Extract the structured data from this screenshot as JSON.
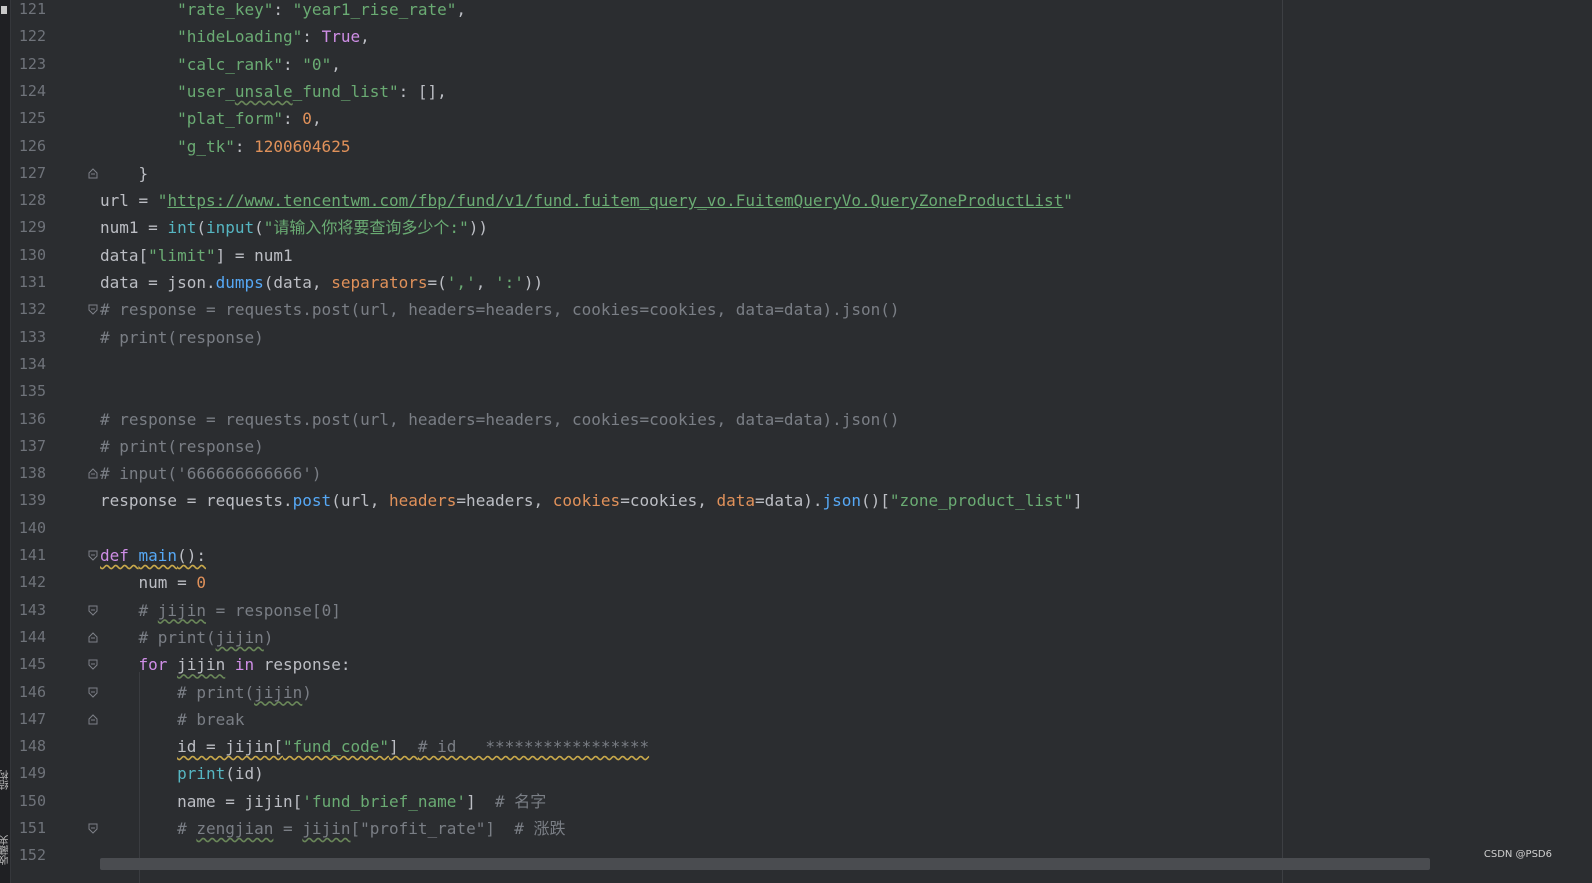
{
  "sidebar": {
    "structure_label": "结构",
    "bookmarks_label": "收藏夹"
  },
  "watermark": "CSDN @PSD6",
  "editor": {
    "lines": [
      {
        "n": "121",
        "fold": "",
        "tokens": [
          [
            "",
            "        "
          ],
          [
            "str",
            "\"rate_key\""
          ],
          [
            "",
            ": "
          ],
          [
            "str",
            "\"year1_rise_rate\""
          ],
          [
            "",
            ","
          ]
        ]
      },
      {
        "n": "122",
        "fold": "",
        "tokens": [
          [
            "",
            "        "
          ],
          [
            "str",
            "\"hideLoading\""
          ],
          [
            "",
            ": "
          ],
          [
            "kw",
            "True"
          ],
          [
            "",
            ","
          ]
        ]
      },
      {
        "n": "123",
        "fold": "",
        "tokens": [
          [
            "",
            "        "
          ],
          [
            "str",
            "\"calc_rank\""
          ],
          [
            "",
            ": "
          ],
          [
            "str",
            "\"0\""
          ],
          [
            "",
            ","
          ]
        ]
      },
      {
        "n": "124",
        "fold": "",
        "tokens": [
          [
            "",
            "        "
          ],
          [
            "str",
            "\"user_"
          ],
          [
            "str squig",
            "unsale"
          ],
          [
            "str",
            "_fund_list\""
          ],
          [
            "",
            ": [],"
          ]
        ]
      },
      {
        "n": "125",
        "fold": "",
        "tokens": [
          [
            "",
            "        "
          ],
          [
            "str",
            "\"plat_form\""
          ],
          [
            "",
            ": "
          ],
          [
            "num",
            "0"
          ],
          [
            "",
            ","
          ]
        ]
      },
      {
        "n": "126",
        "fold": "",
        "tokens": [
          [
            "",
            "        "
          ],
          [
            "str",
            "\"g_tk\""
          ],
          [
            "",
            ": "
          ],
          [
            "num",
            "1200604625"
          ]
        ]
      },
      {
        "n": "127",
        "fold": "end",
        "tokens": [
          [
            "",
            "    }"
          ]
        ]
      },
      {
        "n": "128",
        "fold": "",
        "tokens": [
          [
            "",
            "url = "
          ],
          [
            "str",
            "\""
          ],
          [
            "link",
            "https://www.tencentwm.com/fbp/fund/v1/fund.fuitem_query_vo.FuitemQueryVo.QueryZoneProductList"
          ],
          [
            "str",
            "\""
          ]
        ]
      },
      {
        "n": "129",
        "fold": "",
        "tokens": [
          [
            "",
            "num1 = "
          ],
          [
            "builtin",
            "int"
          ],
          [
            "",
            "("
          ],
          [
            "builtin",
            "input"
          ],
          [
            "",
            "("
          ],
          [
            "str",
            "\"请输入你将要查询多少个:\""
          ],
          [
            "",
            "))"
          ]
        ]
      },
      {
        "n": "130",
        "fold": "",
        "tokens": [
          [
            "",
            "data["
          ],
          [
            "str",
            "\"limit\""
          ],
          [
            "",
            "] = num1"
          ]
        ]
      },
      {
        "n": "131",
        "fold": "",
        "tokens": [
          [
            "",
            "data = json."
          ],
          [
            "fn",
            "dumps"
          ],
          [
            "",
            "(data, "
          ],
          [
            "param",
            "separators"
          ],
          [
            "",
            "=("
          ],
          [
            "str",
            "','"
          ],
          [
            "",
            ", "
          ],
          [
            "str",
            "':'"
          ],
          [
            "",
            "))"
          ]
        ]
      },
      {
        "n": "132",
        "fold": "start",
        "tokens": [
          [
            "cmt",
            "# response = requests.post(url, headers=headers, cookies=cookies, data=data).json()"
          ]
        ]
      },
      {
        "n": "133",
        "fold": "",
        "tokens": [
          [
            "cmt",
            "# print(response)"
          ]
        ]
      },
      {
        "n": "134",
        "fold": "",
        "tokens": []
      },
      {
        "n": "135",
        "fold": "",
        "tokens": []
      },
      {
        "n": "136",
        "fold": "",
        "tokens": [
          [
            "cmt",
            "# response = requests.post(url, headers=headers, cookies=cookies, data=data).json()"
          ]
        ]
      },
      {
        "n": "137",
        "fold": "",
        "tokens": [
          [
            "cmt",
            "# print(response)"
          ]
        ]
      },
      {
        "n": "138",
        "fold": "end",
        "tokens": [
          [
            "cmt",
            "# input('666666666666')"
          ]
        ]
      },
      {
        "n": "139",
        "fold": "",
        "tokens": [
          [
            "",
            "response = requests."
          ],
          [
            "fn",
            "post"
          ],
          [
            "",
            "(url, "
          ],
          [
            "param",
            "headers"
          ],
          [
            "",
            "=headers, "
          ],
          [
            "param",
            "cookies"
          ],
          [
            "",
            "=cookies, "
          ],
          [
            "param",
            "data"
          ],
          [
            "",
            "=data)."
          ],
          [
            "fn",
            "json"
          ],
          [
            "",
            "()["
          ],
          [
            "str",
            "\"zone_product_list\""
          ],
          [
            "",
            "]"
          ]
        ]
      },
      {
        "n": "140",
        "fold": "",
        "tokens": []
      },
      {
        "n": "141",
        "fold": "start",
        "tokens": [
          [
            "kw squig-y",
            "def "
          ],
          [
            "fn squig-y",
            "main"
          ],
          [
            "squig-y",
            "():"
          ]
        ]
      },
      {
        "n": "142",
        "fold": "",
        "tokens": [
          [
            "",
            "    num = "
          ],
          [
            "num",
            "0"
          ]
        ]
      },
      {
        "n": "143",
        "fold": "start",
        "tokens": [
          [
            "cmt",
            "    # "
          ],
          [
            "cmt squig",
            "jijin"
          ],
          [
            "cmt",
            " = response[0]"
          ]
        ]
      },
      {
        "n": "144",
        "fold": "end",
        "tokens": [
          [
            "cmt",
            "    # print("
          ],
          [
            "cmt squig",
            "jijin"
          ],
          [
            "cmt",
            ")"
          ]
        ]
      },
      {
        "n": "145",
        "fold": "start",
        "tokens": [
          [
            "kw",
            "    for "
          ],
          [
            "squig",
            "jijin"
          ],
          [
            "kw",
            " in"
          ],
          [
            "",
            " response:"
          ]
        ]
      },
      {
        "n": "146",
        "fold": "start",
        "tokens": [
          [
            "cmt",
            "        # print("
          ],
          [
            "cmt squig",
            "jijin"
          ],
          [
            "cmt",
            ")"
          ]
        ]
      },
      {
        "n": "147",
        "fold": "end",
        "tokens": [
          [
            "cmt",
            "        # break"
          ]
        ]
      },
      {
        "n": "148",
        "fold": "",
        "tokens": [
          [
            "",
            "        "
          ],
          [
            "squig-y",
            "id = jijin["
          ],
          [
            "str squig-y",
            "\"fund_code\""
          ],
          [
            "squig-y",
            "]  "
          ],
          [
            "cmt squig-y",
            "# id   *****************"
          ]
        ]
      },
      {
        "n": "149",
        "fold": "",
        "tokens": [
          [
            "",
            "        "
          ],
          [
            "builtin",
            "print"
          ],
          [
            "",
            "(id)"
          ]
        ]
      },
      {
        "n": "150",
        "fold": "",
        "tokens": [
          [
            "",
            "        name = jijin["
          ],
          [
            "str",
            "'fund_brief_name'"
          ],
          [
            "",
            "]  "
          ],
          [
            "cmt",
            "# 名字"
          ]
        ]
      },
      {
        "n": "151",
        "fold": "start",
        "tokens": [
          [
            "cmt",
            "        # "
          ],
          [
            "cmt squig",
            "zengjian"
          ],
          [
            "cmt",
            " = "
          ],
          [
            "cmt squig",
            "jijin"
          ],
          [
            "cmt",
            "[\"profit_rate\"]  # 涨跌"
          ]
        ]
      },
      {
        "n": "152",
        "fold": "",
        "tokens": []
      }
    ]
  }
}
